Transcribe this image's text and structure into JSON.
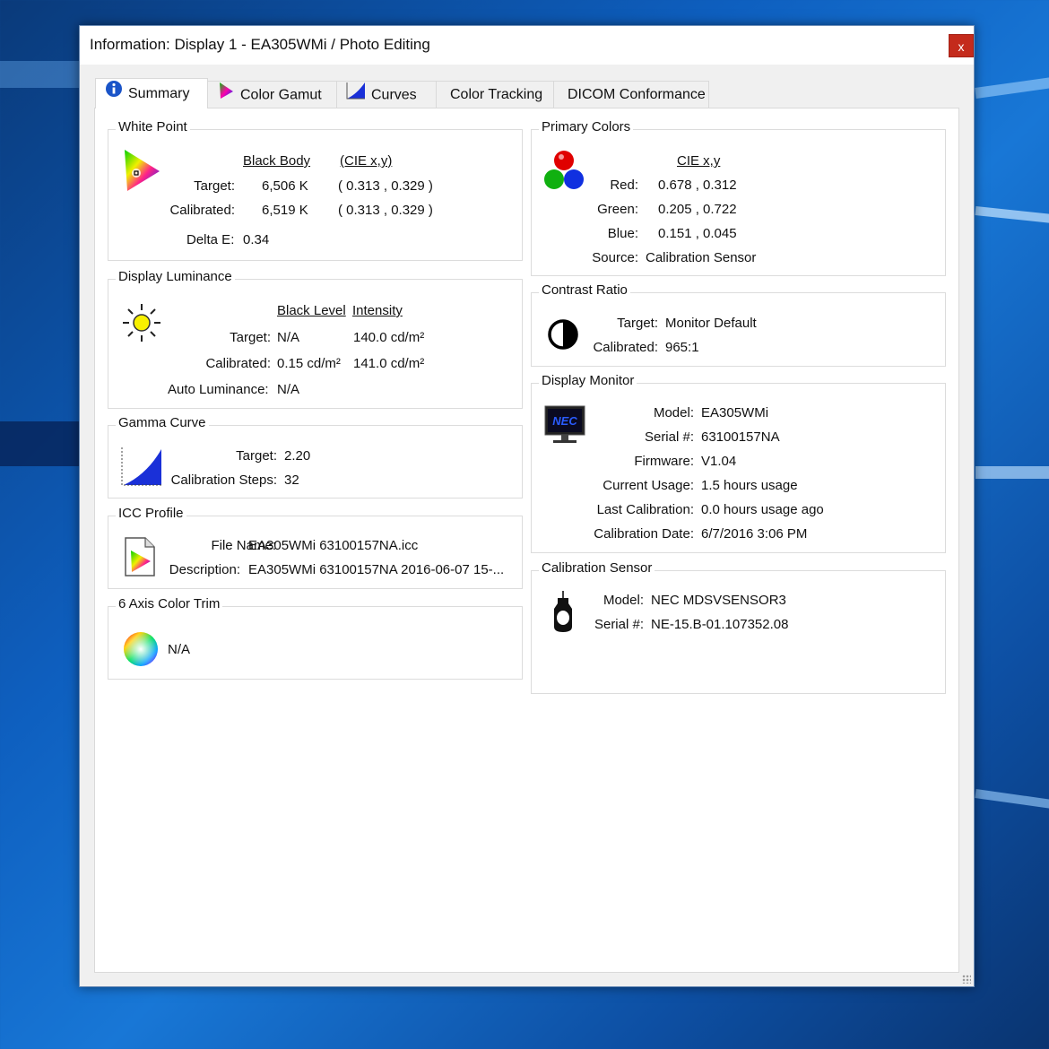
{
  "window": {
    "title": "Information: Display 1 - EA305WMi / Photo Editing",
    "close_label": "x"
  },
  "tabs": [
    {
      "label": "Summary",
      "icon": "info-icon"
    },
    {
      "label": "Color Gamut",
      "icon": "color-gamut-icon"
    },
    {
      "label": "Curves",
      "icon": "curves-icon"
    },
    {
      "label": "Color Tracking"
    },
    {
      "label": "DICOM Conformance"
    }
  ],
  "white_point": {
    "title": "White Point",
    "col_black_body": "Black Body",
    "col_cie": "(CIE x,y)",
    "target_label": "Target:",
    "target_bb": "6,506 K",
    "target_cie": "( 0.313 , 0.329 )",
    "calibrated_label": "Calibrated:",
    "calibrated_bb": "6,519 K",
    "calibrated_cie": "( 0.313 , 0.329 )",
    "delta_label": "Delta E:",
    "delta_value": "0.34"
  },
  "luminance": {
    "title": "Display Luminance",
    "col_black": "Black Level",
    "col_intensity": "Intensity",
    "target_label": "Target:",
    "target_black": "N/A",
    "target_intensity": "140.0 cd/m²",
    "calibrated_label": "Calibrated:",
    "calibrated_black": "0.15 cd/m²",
    "calibrated_intensity": "141.0 cd/m²",
    "auto_label": "Auto Luminance:",
    "auto_value": "N/A"
  },
  "gamma": {
    "title": "Gamma Curve",
    "target_label": "Target:",
    "target_value": "2.20",
    "steps_label": "Calibration Steps:",
    "steps_value": "32"
  },
  "icc": {
    "title": "ICC Profile",
    "file_label": "File Name:",
    "file_value": "EA305WMi 63100157NA.icc",
    "desc_label": "Description:",
    "desc_value": "EA305WMi 63100157NA 2016-06-07 15-..."
  },
  "trim": {
    "title": "6 Axis Color Trim",
    "value": "N/A"
  },
  "primaries": {
    "title": "Primary Colors",
    "col_cie": "CIE x,y",
    "red_label": "Red:",
    "red_value": "0.678 , 0.312",
    "green_label": "Green:",
    "green_value": "0.205 , 0.722",
    "blue_label": "Blue:",
    "blue_value": "0.151 , 0.045",
    "source_label": "Source:",
    "source_value": "Calibration Sensor"
  },
  "contrast": {
    "title": "Contrast Ratio",
    "target_label": "Target:",
    "target_value": "Monitor Default",
    "calibrated_label": "Calibrated:",
    "calibrated_value": "965:1"
  },
  "monitor": {
    "title": "Display Monitor",
    "logo_text": "NEC",
    "model_label": "Model:",
    "model_value": "EA305WMi",
    "serial_label": "Serial #:",
    "serial_value": "63100157NA",
    "firmware_label": "Firmware:",
    "firmware_value": "V1.04",
    "usage_label": "Current Usage:",
    "usage_value": "1.5 hours usage",
    "lastcal_label": "Last Calibration:",
    "lastcal_value": "0.0 hours usage ago",
    "caldate_label": "Calibration Date:",
    "caldate_value": "6/7/2016 3:06 PM"
  },
  "sensor": {
    "title": "Calibration Sensor",
    "model_label": "Model:",
    "model_value": "NEC MDSVSENSOR3",
    "serial_label": "Serial #:",
    "serial_value": "NE-15.B-01.107352.08"
  },
  "colors": {
    "close_red": "#c42b1c",
    "tab_blue": "#1a54c8"
  }
}
